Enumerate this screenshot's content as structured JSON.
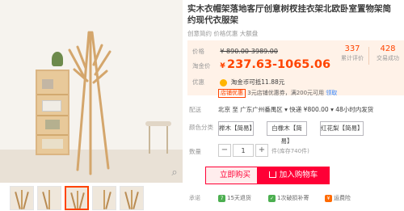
{
  "product": {
    "title": "实木衣帽架落地客厅创意树杈挂衣架北欧卧室置物架简约现代衣服架",
    "subtitle": "创意简约 价格优惠 大额盘"
  },
  "stats": [
    {
      "num": "337",
      "label": "累计评价"
    },
    {
      "num": "428",
      "label": "交易成功"
    }
  ],
  "price": {
    "label": "价格",
    "original": "¥ 890.00-3989.00",
    "tb_label": "淘金价",
    "currency": "¥",
    "tb_value": "237.63-1065.06",
    "youhui_label": "优惠",
    "youhui_text": "淘金币可抵11.88元"
  },
  "events": {
    "tag": "店铺优惠",
    "text": "3元店铺优惠券，满200元可用",
    "more": "领取"
  },
  "shipping": {
    "label": "配送",
    "text": "北京 至 广东广州番禺区 ▾ 快递 ¥800.00 ▾ 48小时内发货"
  },
  "color": {
    "label": "颜色分类",
    "options": [
      "榉木【简易】",
      "白橡木【简易】",
      "红花梨【简易】"
    ]
  },
  "quantity": {
    "label": "数量",
    "minus": "−",
    "value": "1",
    "plus": "+",
    "unit": "件(库存740件)"
  },
  "buttons": {
    "buy": "立即购买",
    "cart": "加入购物车"
  },
  "promise": {
    "label": "承诺",
    "items": [
      {
        "badge": "7",
        "text": "15天退货",
        "color": "#4caf50"
      },
      {
        "badge": "✓",
        "text": "1次破损补寄",
        "color": "#4caf50"
      },
      {
        "badge": "¥",
        "text": "运费险",
        "color": "#ff6a00"
      }
    ]
  },
  "colors": {
    "accent": "#ff4400",
    "buy_border": "#ff0036",
    "price_bg": "#fff2e8"
  }
}
